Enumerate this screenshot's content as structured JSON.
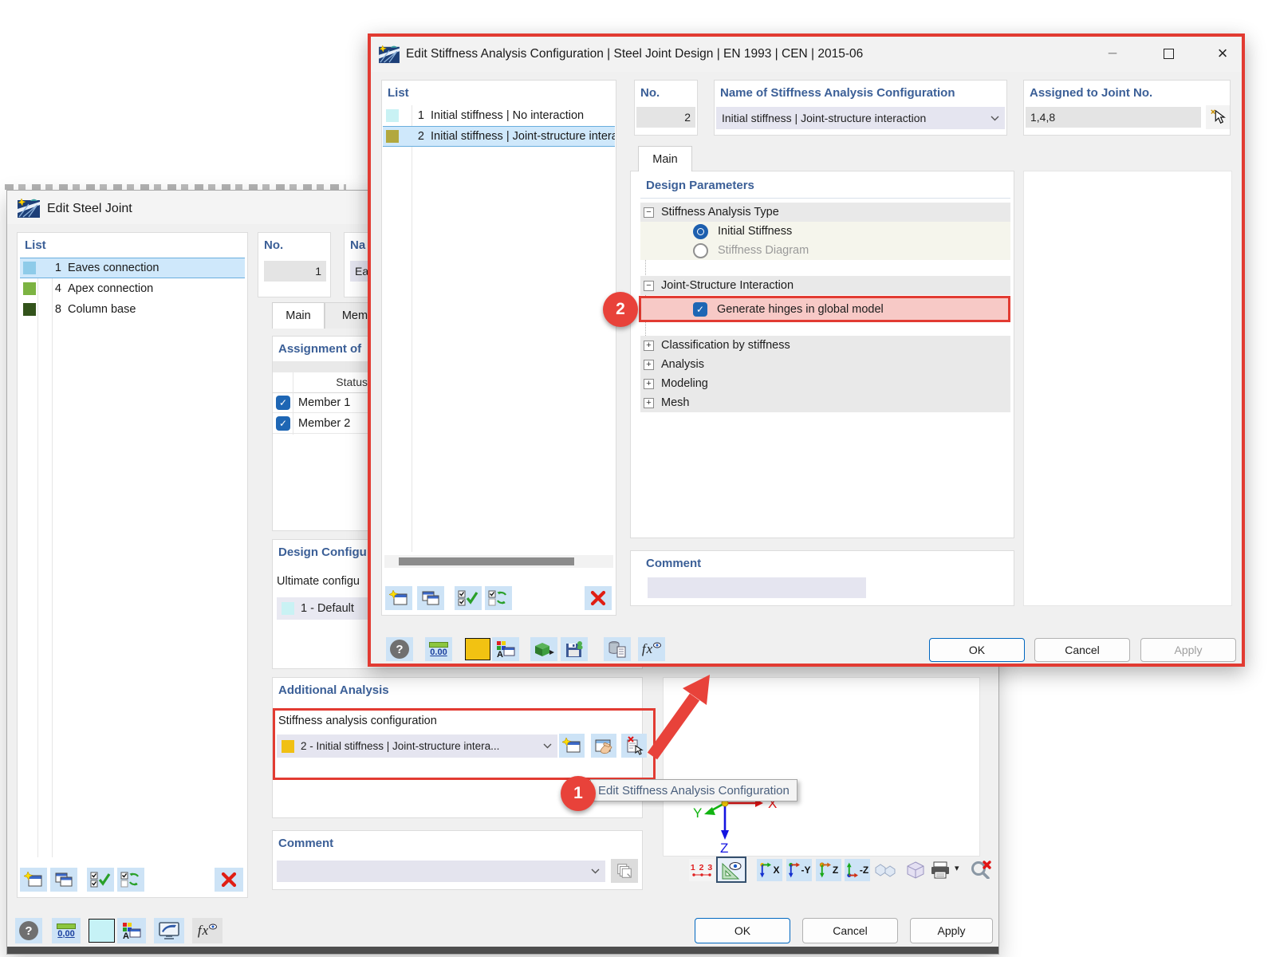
{
  "colors": {
    "annotation_red": "#e8423a",
    "highlight_pink": "#f7c9c6",
    "selection_blue": "#cfe8fb",
    "group_header_blue": "#3b5f97",
    "icon_button_blue": "#cde3f6",
    "checkbox_blue": "#1e66b4"
  },
  "icons": {
    "minimize": "–",
    "close": "×",
    "help": "?",
    "collapse": "−",
    "expand": "+",
    "check": "✓",
    "caret_down": "▾"
  },
  "annotations": {
    "step_1": "1",
    "step_2": "2",
    "tooltip": "Edit Stiffness Analysis Configuration"
  },
  "stiffness_dialog": {
    "title": "Edit Stiffness Analysis Configuration | Steel Joint Design | EN 1993 | CEN | 2015-06",
    "list": {
      "header": "List",
      "items": [
        {
          "no": "1",
          "label": "Initial stiffness | No interaction",
          "color": "#c9f2f4"
        },
        {
          "no": "2",
          "label": "Initial stiffness | Joint-structure intera",
          "color": "#b2a83e"
        }
      ]
    },
    "no_field": {
      "label": "No.",
      "value": "2"
    },
    "name_field": {
      "label": "Name of Stiffness Analysis Configuration",
      "value": "Initial stiffness | Joint-structure interaction"
    },
    "assigned_field": {
      "label": "Assigned to Joint No.",
      "value": "1,4,8"
    },
    "tab_main": "Main",
    "design_parameters": {
      "header": "Design Parameters",
      "stiffness_analysis_type": "Stiffness Analysis Type",
      "initial_stiffness": "Initial Stiffness",
      "stiffness_diagram": "Stiffness Diagram",
      "joint_structure_interaction": "Joint-Structure Interaction",
      "generate_hinges": "Generate hinges in global model",
      "classification": "Classification by stiffness",
      "analysis": "Analysis",
      "modeling": "Modeling",
      "mesh": "Mesh"
    },
    "comment": {
      "header": "Comment",
      "value": ""
    },
    "toolbar_units": "0.00",
    "buttons": {
      "ok": "OK",
      "cancel": "Cancel",
      "apply": "Apply"
    }
  },
  "steel_joint_dialog": {
    "title": "Edit Steel Joint",
    "list": {
      "header": "List",
      "items": [
        {
          "no": "1",
          "label": "Eaves connection",
          "color": "#8ecbe9"
        },
        {
          "no": "4",
          "label": "Apex connection",
          "color": "#7cb342"
        },
        {
          "no": "8",
          "label": "Column base",
          "color": "#33531b"
        }
      ]
    },
    "no_field": {
      "label": "No.",
      "value": "1"
    },
    "name_field": {
      "label": "Na",
      "value": "Eav"
    },
    "tabs": {
      "main": "Main",
      "members": "Membe"
    },
    "assignment": {
      "header": "Assignment of",
      "status_column": "Status",
      "members": [
        "Member 1",
        "Member 2"
      ]
    },
    "design_configuration": {
      "header": "Design Configu",
      "ultimate_label": "Ultimate configu",
      "value": "1 - Default",
      "value_color": "#c9f2f4"
    },
    "additional_analysis": {
      "header": "Additional Analysis",
      "label": "Stiffness analysis configuration",
      "value": "2 - Initial stiffness | Joint-structure intera...",
      "value_color": "#f0c013"
    },
    "comment": {
      "header": "Comment",
      "value": ""
    },
    "viewport": {
      "axis_x": "X",
      "axis_y": "Y",
      "axis_z": "Z",
      "view_labels": [
        "X",
        "-Y",
        "Z",
        "-Z"
      ],
      "numbering": "1 2 3"
    },
    "toolbar_units": "0,00",
    "buttons": {
      "ok": "OK",
      "cancel": "Cancel",
      "apply": "Apply"
    }
  }
}
